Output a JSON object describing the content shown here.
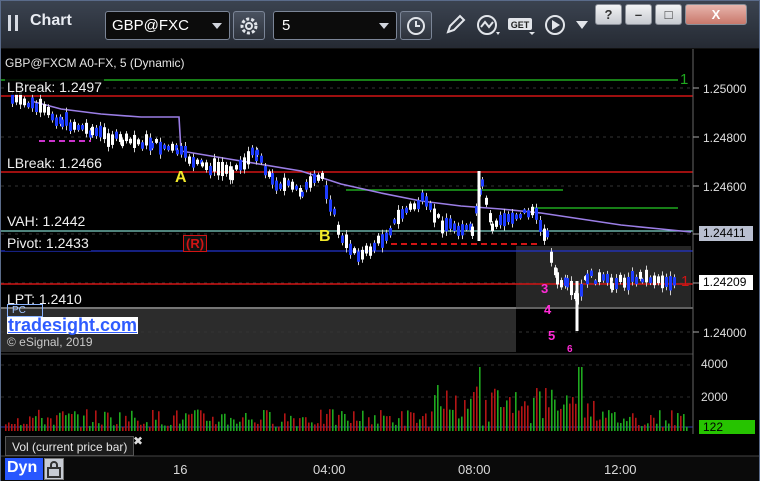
{
  "app": {
    "title": "Chart"
  },
  "toolbar": {
    "symbol": "GBP@FXC",
    "interval": "5",
    "get_label": "GET",
    "window_buttons": [
      "?",
      "–",
      "□",
      "X"
    ]
  },
  "chart": {
    "title": "GBP@FXCM A0-FX, 5 (Dynamic)",
    "levels": [
      {
        "label": "LBreak: 1.2497",
        "price": 1.2497
      },
      {
        "label": "LBreak: 1.2466",
        "price": 1.2466
      },
      {
        "label": "VAH: 1.2442",
        "price": 1.2442
      },
      {
        "label": "Pivot: 1.2433",
        "price": 1.2433
      },
      {
        "label": "LPT: 1.2410",
        "price": 1.241
      }
    ],
    "price_axis": [
      "1.25000",
      "1.24800",
      "1.24600",
      "1.24400",
      "1.24200",
      "1.24000"
    ],
    "last_price_tags": [
      {
        "label": "1.24411",
        "color": "#b9bfd0"
      },
      {
        "label": "1.24209",
        "color": "#ffffff"
      }
    ],
    "markers": {
      "a": "A",
      "b": "B",
      "r": "(R)",
      "one_top": "1",
      "one_right": "1",
      "seq": [
        "3",
        "4",
        "5",
        "6"
      ]
    },
    "brand": "tradesight.com",
    "copyright": "© eSignal, 2019",
    "pc_label": "PC"
  },
  "volume": {
    "label": "Vol (current price bar)",
    "axis": [
      "4000",
      "2000"
    ],
    "last_value": "122",
    "last_color": "#26c300",
    "close": "✖"
  },
  "status": {
    "mode": "Dyn"
  },
  "time_axis": [
    "16",
    "04:00",
    "08:00",
    "12:00"
  ],
  "colors": {
    "up": "#ffffff",
    "down": "#1e3cff",
    "vwap": "#9b7ee6",
    "resist": "#cc1111",
    "support": "#1e9a1e"
  }
}
